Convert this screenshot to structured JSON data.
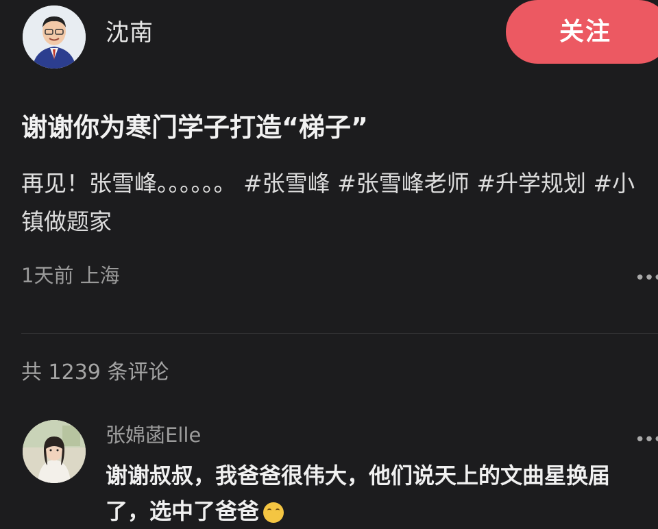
{
  "author": {
    "name": "沈南"
  },
  "follow_button": {
    "label": "关注"
  },
  "post": {
    "title": "谢谢你为寒门学子打造“梯子”",
    "body_text": "再见！张雪峰。。。。。。",
    "hashtags": [
      "#张雪峰",
      "#张雪峰老师",
      "#升学规划",
      "#小镇做题家"
    ],
    "time": "1天前",
    "location": "上海"
  },
  "comments_section": {
    "count_label": "共 1239 条评论"
  },
  "comments": [
    {
      "user": "张婂菡Elle",
      "text": "谢谢叔叔，我爸爸很伟大，他们说天上的文曲星换届了，选中了爸爸",
      "emoji": "crying-face-icon"
    }
  ],
  "icons": {
    "more": "more-icon",
    "author_avatar": "avatar",
    "commenter_avatar": "avatar"
  },
  "colors": {
    "background": "#1c1c1e",
    "follow_button": "#ec5962"
  }
}
